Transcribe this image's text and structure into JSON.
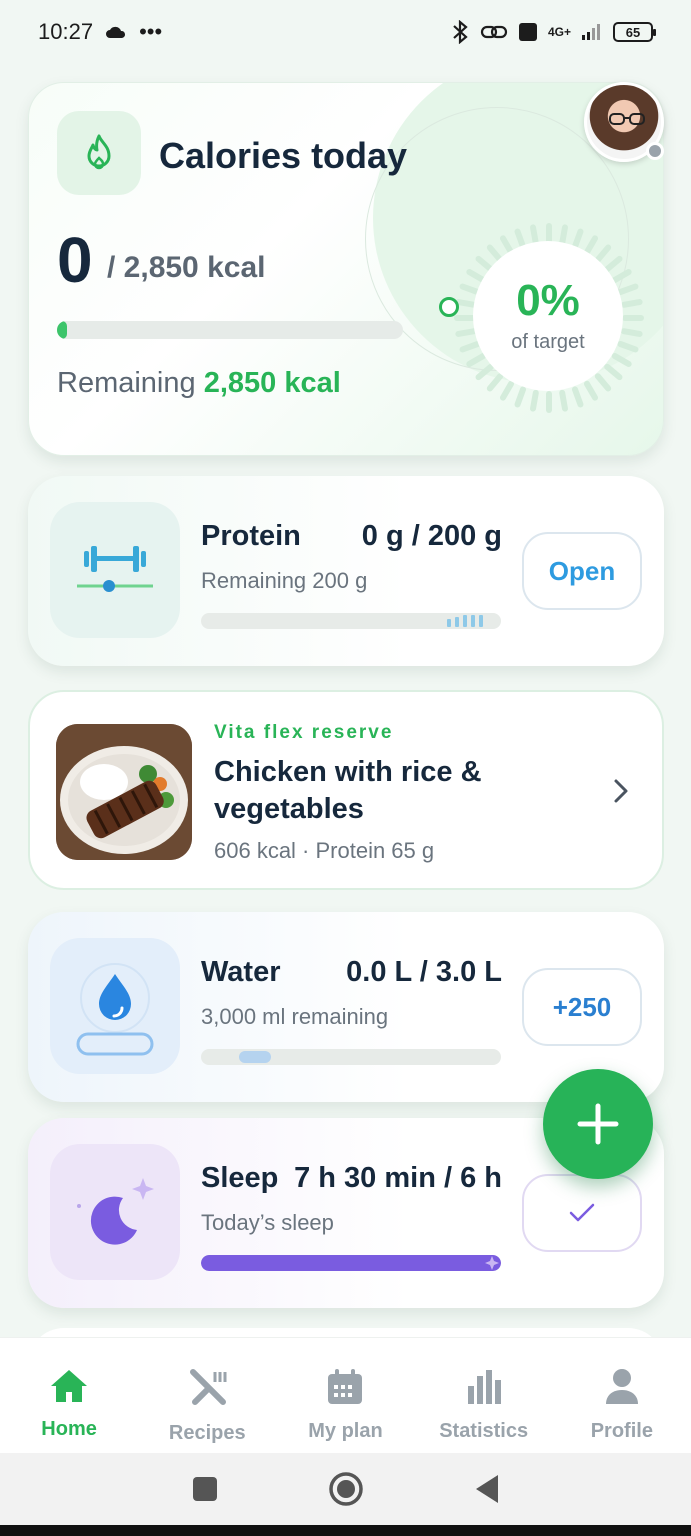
{
  "status_bar": {
    "time": "10:27",
    "dots": "•••",
    "network": "4G+",
    "battery": "65"
  },
  "calories": {
    "title": "Calories today",
    "consumed": "0",
    "target": "/ 2,850 kcal",
    "progress": 0.0,
    "remaining_label": "Remaining",
    "remaining_value": "2,850 kcal",
    "percent": "0%",
    "percent_label": "of target"
  },
  "protein": {
    "title": "Protein",
    "value": "0 g / 200 g",
    "subtitle": "Remaining 200 g",
    "button": "Open",
    "progress": 0.0
  },
  "recipe": {
    "brand": "Vita flex reserve",
    "title": "Chicken with rice & vegetables",
    "meta": "606 kcal · Protein 65 g"
  },
  "water": {
    "title": "Water",
    "value": "0.0 L / 3.0 L",
    "subtitle": "3,000 ml remaining",
    "button": "+250",
    "progress": 0.0
  },
  "sleep": {
    "title": "Sleep",
    "value": "7 h 30 min / 6 h",
    "subtitle": "Today’s sleep",
    "progress": 1.0
  },
  "nav": {
    "items": [
      {
        "label": "Home",
        "icon": "home-icon",
        "active": true
      },
      {
        "label": "Recipes",
        "icon": "recipes-icon",
        "active": false
      },
      {
        "label": "My plan",
        "icon": "calendar-icon",
        "active": false
      },
      {
        "label": "Statistics",
        "icon": "statistics-icon",
        "active": false
      },
      {
        "label": "Profile",
        "icon": "profile-icon",
        "active": false
      }
    ]
  },
  "colors": {
    "accent_green": "#29b457",
    "water_blue": "#2e9be0",
    "sleep_purple": "#7a5ce0"
  }
}
